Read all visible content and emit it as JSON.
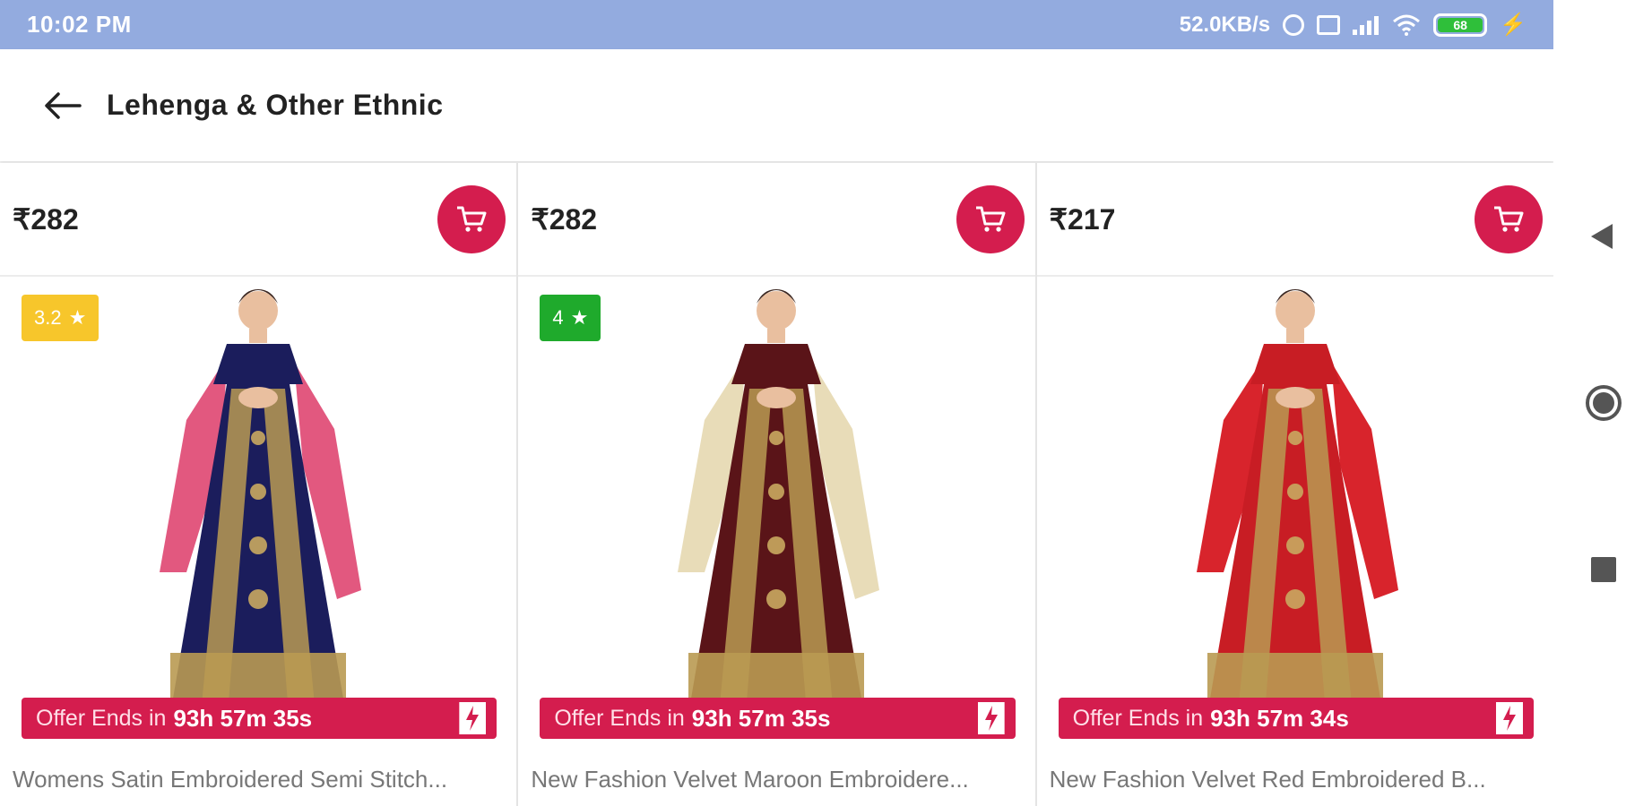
{
  "status_bar": {
    "time": "10:02 PM",
    "net_speed": "52.0KB/s",
    "battery_level": "68",
    "icons": [
      "alarm-icon",
      "sim-icon",
      "signal-icon",
      "wifi-icon",
      "battery-icon",
      "charging-bolt-icon"
    ]
  },
  "header": {
    "back_icon": "arrow-left-icon",
    "title": "Lehenga & Other Ethnic"
  },
  "colors": {
    "status_bar": "#93abdf",
    "accent": "#d41d4e",
    "rating_yellow": "#f7c62b",
    "rating_green": "#1faa2c"
  },
  "products": [
    {
      "price": "₹282",
      "rating": "3.2",
      "rating_color": "#f7c62b",
      "offer_label": "Offer Ends in",
      "offer_time": "93h 57m 35s",
      "name": "Womens Satin Embroidered Semi Stitch...",
      "dress_primary": "#1b1d5c",
      "dupatta": "#e2587f"
    },
    {
      "price": "₹282",
      "rating": "4",
      "rating_color": "#1faa2c",
      "offer_label": "Offer Ends in",
      "offer_time": "93h 57m 35s",
      "name": "New Fashion Velvet Maroon Embroidere...",
      "dress_primary": "#5a1418",
      "dupatta": "#e8dcb8"
    },
    {
      "price": "₹217",
      "rating": "",
      "rating_color": "",
      "offer_label": "Offer Ends in",
      "offer_time": "93h 57m 34s",
      "name": "New Fashion Velvet Red Embroidered B...",
      "dress_primary": "#c81d24",
      "dupatta": "#d8242c"
    }
  ],
  "nav_bar": {
    "icons": [
      "nav-back-icon",
      "nav-home-icon",
      "nav-recents-icon"
    ]
  }
}
